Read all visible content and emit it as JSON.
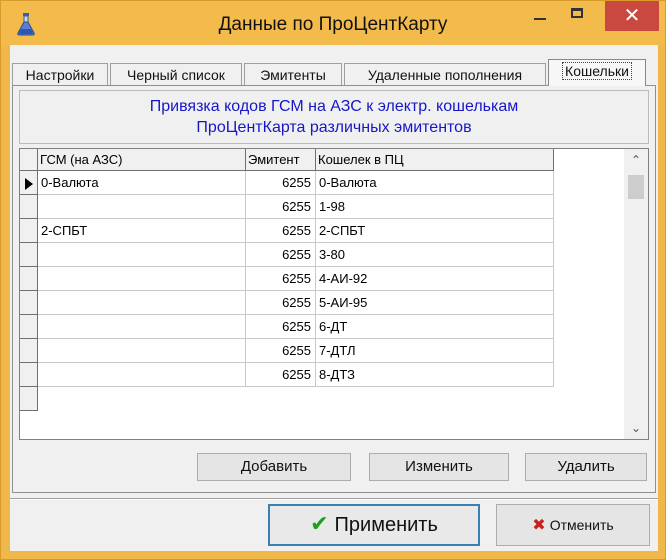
{
  "window": {
    "title": "Данные по ПроЦентКарту",
    "icon": "flask-icon",
    "close_glyph": "✕"
  },
  "tabs": [
    {
      "label": "Настройки",
      "active": false
    },
    {
      "label": "Черный список",
      "active": false
    },
    {
      "label": "Эмитенты",
      "active": false
    },
    {
      "label": "Удаленные пополнения",
      "active": false
    },
    {
      "label": "Кошельки",
      "active": true
    }
  ],
  "panel": {
    "heading_line1": "Привязка кодов ГСМ на АЗС к электр. кошелькам",
    "heading_line2": "ПроЦентКарта различных эмитентов"
  },
  "grid": {
    "columns": [
      "ГСМ (на АЗС)",
      "Эмитент",
      "Кошелек в ПЦ"
    ],
    "rows": [
      {
        "gsm": "0-Валюта",
        "emitent": "6255",
        "wallet": "0-Валюта",
        "current": true
      },
      {
        "gsm": "",
        "emitent": "6255",
        "wallet": "1-98",
        "current": false
      },
      {
        "gsm": "2-СПБТ",
        "emitent": "6255",
        "wallet": "2-СПБТ",
        "current": false
      },
      {
        "gsm": "",
        "emitent": "6255",
        "wallet": "3-80",
        "current": false
      },
      {
        "gsm": "",
        "emitent": "6255",
        "wallet": "4-АИ-92",
        "current": false
      },
      {
        "gsm": "",
        "emitent": "6255",
        "wallet": "5-АИ-95",
        "current": false
      },
      {
        "gsm": "",
        "emitent": "6255",
        "wallet": "6-ДТ",
        "current": false
      },
      {
        "gsm": "",
        "emitent": "6255",
        "wallet": "7-ДТЛ",
        "current": false
      },
      {
        "gsm": "",
        "emitent": "6255",
        "wallet": "8-ДТЗ",
        "current": false
      }
    ]
  },
  "actions": {
    "add": "Добавить",
    "edit": "Изменить",
    "delete": "Удалить"
  },
  "footer": {
    "apply": "Применить",
    "cancel": "Отменить"
  },
  "colors": {
    "title_bar": "#f3ba4c",
    "close_button": "#c9483f",
    "heading_text": "#1717c8",
    "apply_check": "#1aa01a",
    "cancel_x": "#cc1d1d"
  }
}
